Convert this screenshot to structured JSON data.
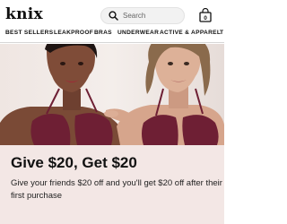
{
  "header": {
    "logo": "knix",
    "search_placeholder": "Search",
    "cart_count": "0"
  },
  "nav": {
    "items": [
      "BEST SELLERS",
      "LEAKPROOF",
      "BRAS",
      "UNDERWEAR",
      "ACTIVE & APPAREL",
      "T"
    ]
  },
  "promo": {
    "title": "Give $20, Get $20",
    "body": "Give your friends $20 off and you'll get $20 off after their first purchase"
  },
  "colors": {
    "promo_bg": "#f3e7e5",
    "hero_bg": "#f5efec",
    "bra_color": "#6e1f34"
  }
}
